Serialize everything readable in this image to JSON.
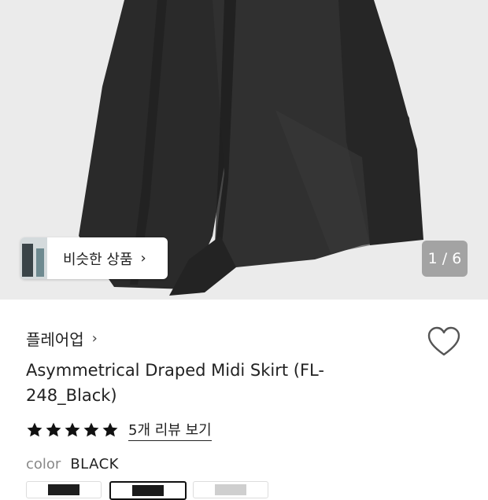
{
  "gallery": {
    "similar_label": "비슷한 상품",
    "similar_chevron": "›",
    "pager": "1 / 6",
    "thumb_icon": "similar-product-thumbnail"
  },
  "product": {
    "brand": "플레어업",
    "brand_chevron": "›",
    "title": "Asymmetrical Draped Midi Skirt (FL-248_Black)",
    "rating": 5,
    "rating_max": 5,
    "review_link": "5개 리뷰 보기",
    "color_label": "color",
    "color_value": "BLACK",
    "wishlist_icon": "heart-outline-icon",
    "star_icon": "star-filled-icon"
  },
  "colors": {
    "background": "#ebebeb",
    "skirt": "#2b2b2b",
    "pager_bg": "#7a7a7a",
    "text": "#222222"
  },
  "swatches": [
    {
      "name": "black-swatch-1",
      "selected": false
    },
    {
      "name": "black-swatch-2",
      "selected": true
    },
    {
      "name": "grey-swatch-3",
      "selected": false
    }
  ]
}
